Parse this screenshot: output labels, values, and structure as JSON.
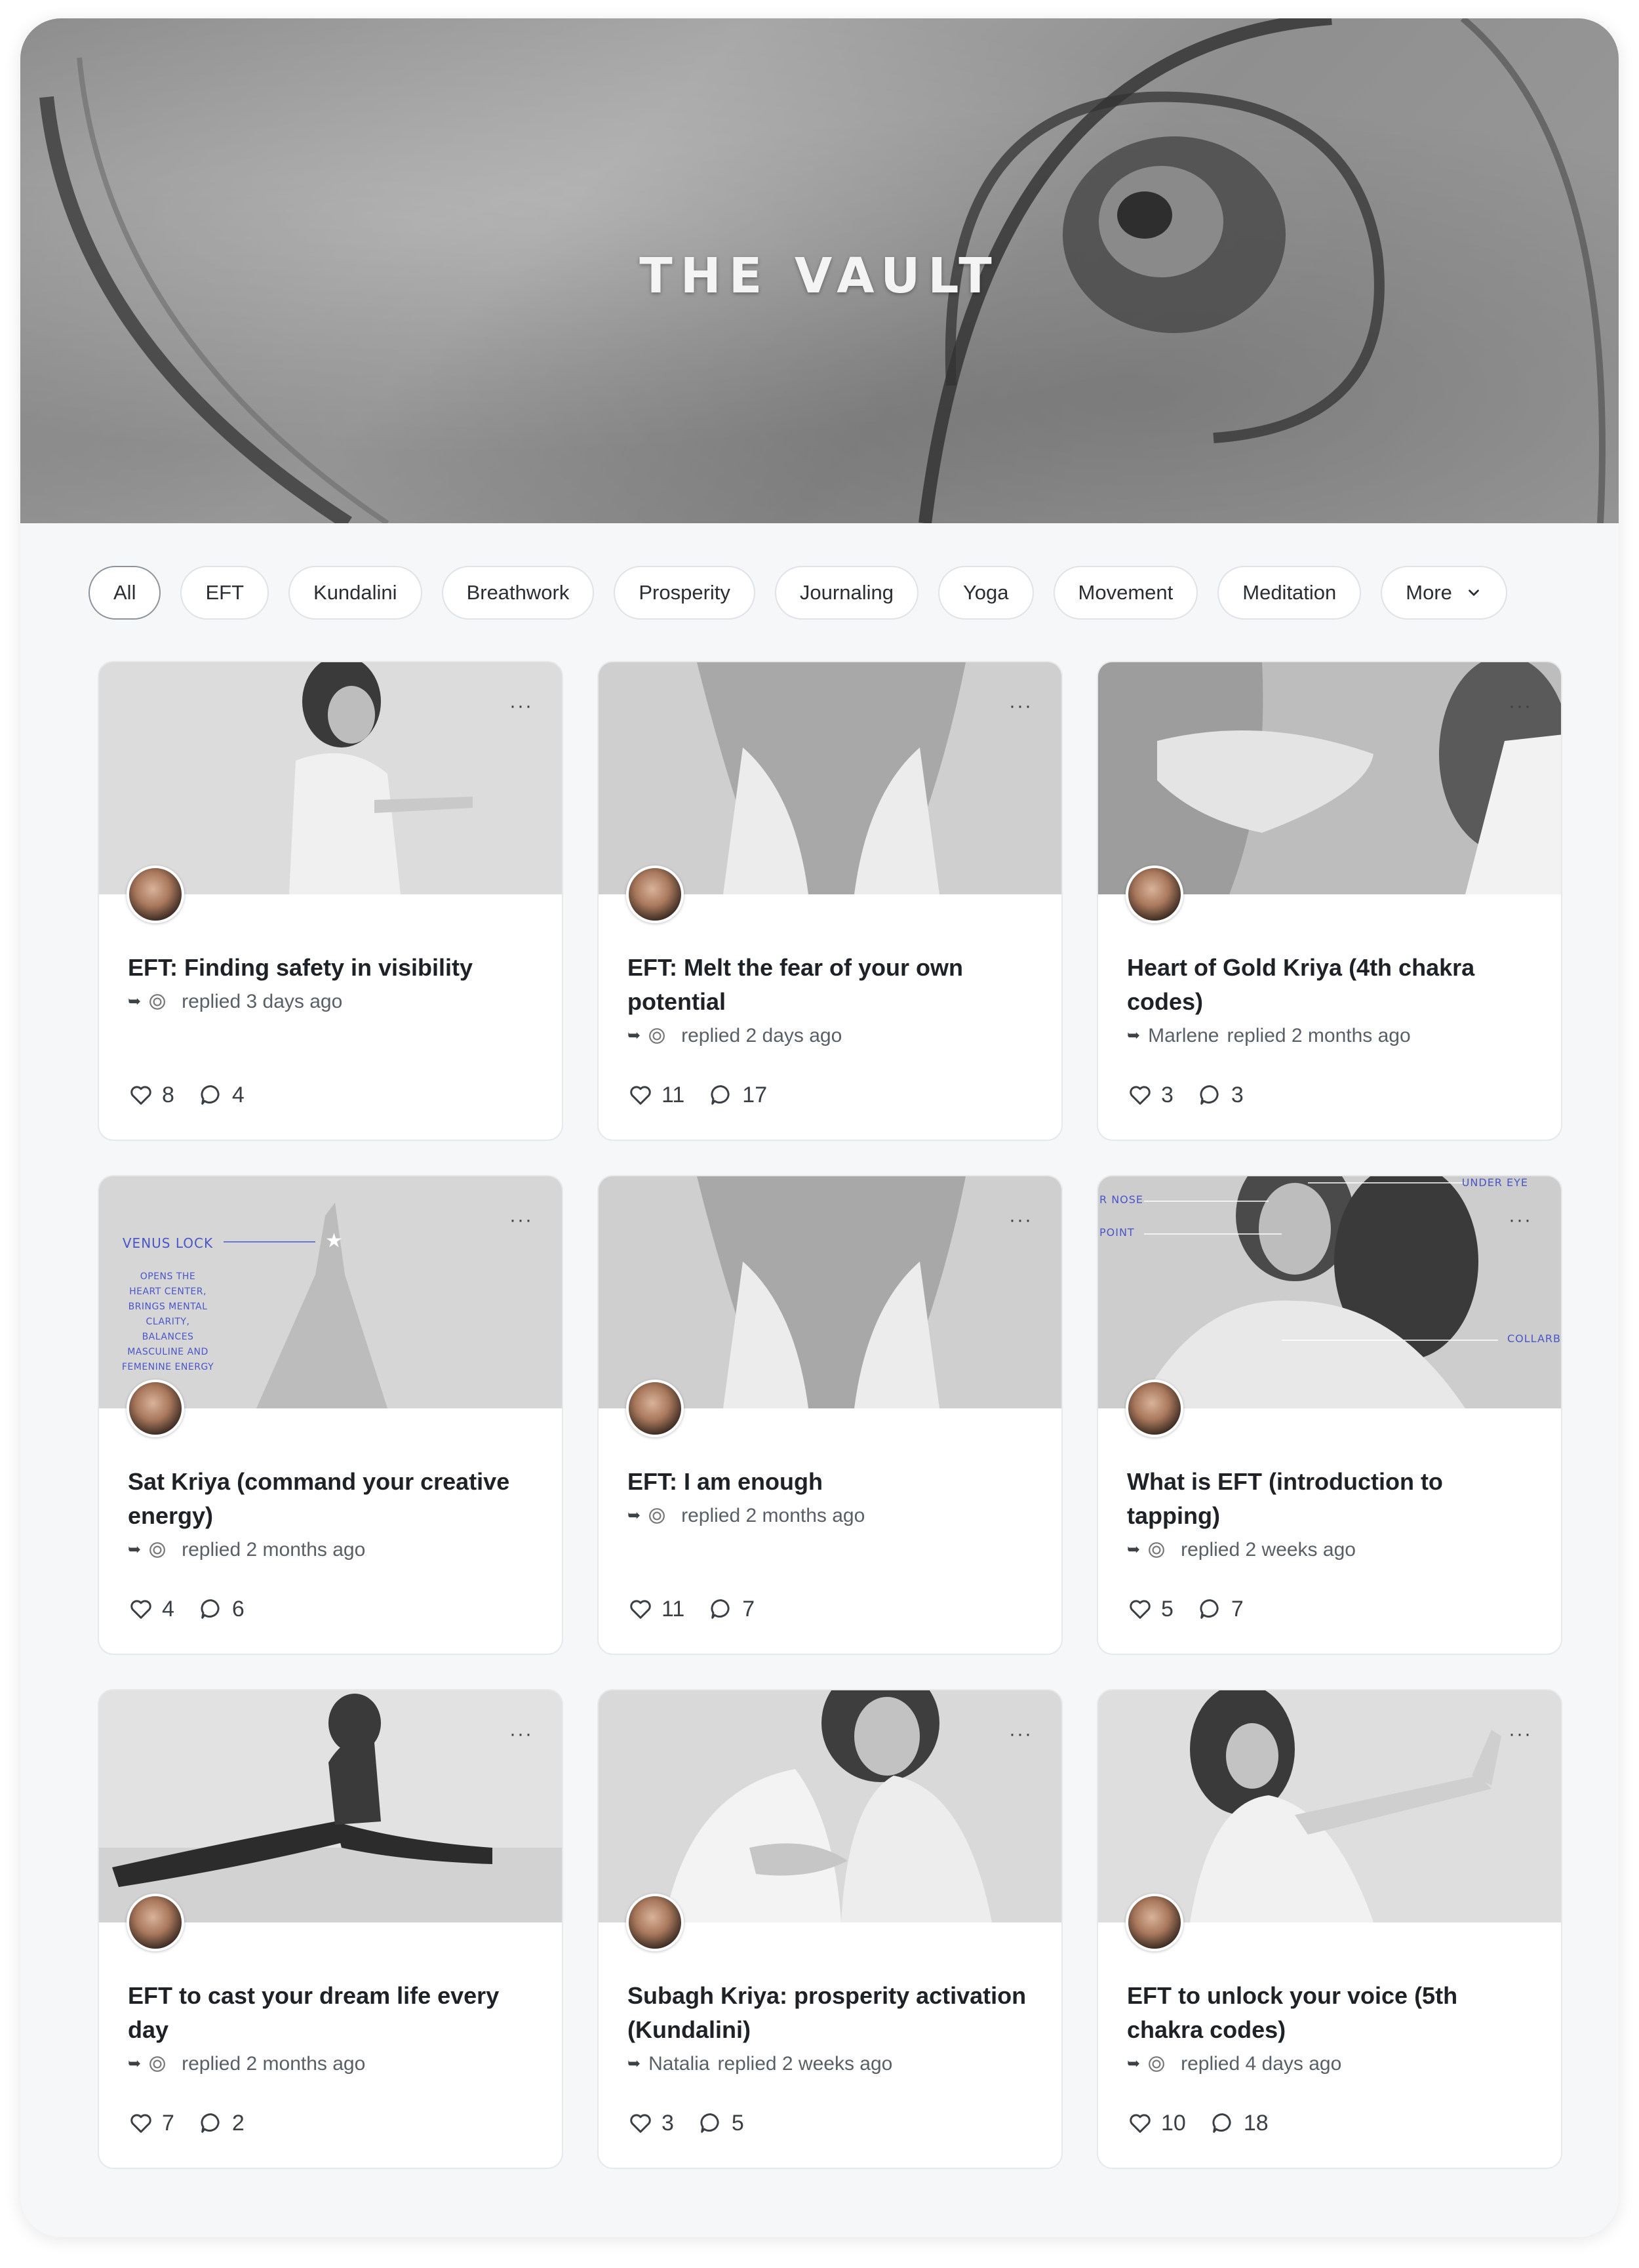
{
  "banner": {
    "title": "THE VAULT"
  },
  "filters": [
    {
      "label": "All",
      "active": true
    },
    {
      "label": "EFT",
      "active": false
    },
    {
      "label": "Kundalini",
      "active": false
    },
    {
      "label": "Breathwork",
      "active": false
    },
    {
      "label": "Prosperity",
      "active": false
    },
    {
      "label": "Journaling",
      "active": false
    },
    {
      "label": "Yoga",
      "active": false
    },
    {
      "label": "Movement",
      "active": false
    },
    {
      "label": "Meditation",
      "active": false
    },
    {
      "label": "More",
      "active": false,
      "icon": "chevron-down-icon"
    }
  ],
  "cards": [
    {
      "title": "EFT: Finding safety in visibility",
      "replier": "",
      "reply": "replied 3 days ago",
      "likes": "8",
      "comments": "4",
      "more": "···"
    },
    {
      "title": "EFT: Melt the fear of your own potential",
      "replier": "",
      "reply": "replied 2 days ago",
      "likes": "11",
      "comments": "17",
      "more": "···"
    },
    {
      "title": "Heart of Gold Kriya (4th chakra codes)",
      "replier": "Marlene",
      "reply": "replied 2 months ago",
      "likes": "3",
      "comments": "3",
      "more": "···"
    },
    {
      "title": "Sat Kriya (command your creative energy)",
      "replier": "",
      "reply": "replied 2 months ago",
      "likes": "4",
      "comments": "6",
      "more": "···",
      "overlay": {
        "heading": "VENUS LOCK",
        "lines": [
          "OPENS THE",
          "HEART CENTER,",
          "BRINGS MENTAL",
          "CLARITY, BALANCES",
          "MASCULINE AND",
          "FEMENINE ENERGY"
        ]
      }
    },
    {
      "title": "EFT: I am enough",
      "replier": "",
      "reply": "replied 2 months ago",
      "likes": "11",
      "comments": "7",
      "more": "···"
    },
    {
      "title": "What is EFT (introduction to tapping)",
      "replier": "",
      "reply": "replied 2 weeks ago",
      "likes": "5",
      "comments": "7",
      "more": "···",
      "overlay": {
        "labels": [
          "UNDER EYE",
          "R NOSE",
          "POINT",
          "COLLARB"
        ]
      }
    },
    {
      "title": "EFT to cast your dream life every day",
      "replier": "",
      "reply": "replied 2 months ago",
      "likes": "7",
      "comments": "2",
      "more": "···"
    },
    {
      "title": "Subagh Kriya: prosperity activation (Kundalini)",
      "replier": "Natalia",
      "reply": "replied 2 weeks ago",
      "likes": "3",
      "comments": "5",
      "more": "···"
    },
    {
      "title": "EFT to unlock your voice (5th chakra codes)",
      "replier": "",
      "reply": "replied 4 days ago",
      "likes": "10",
      "comments": "18",
      "more": "···"
    }
  ],
  "colors": {
    "overlay_text": "#4a55c8",
    "page_bg": "#f6f7f9",
    "card_border": "#e6e8eb"
  }
}
